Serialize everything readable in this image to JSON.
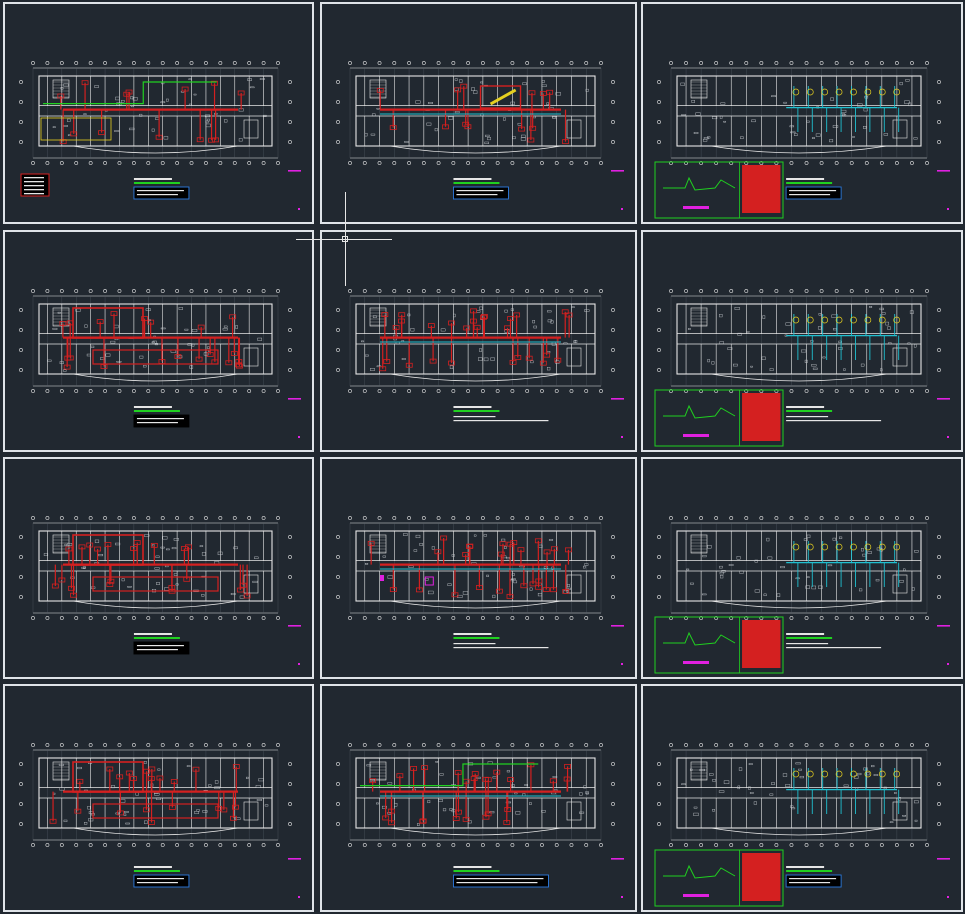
{
  "app": {
    "view": "model-space-multisheet"
  },
  "colors": {
    "background": "#212830",
    "frame": "#dfe3e8",
    "wall": "#e6e6e6",
    "duct_red": "#d42020",
    "green": "#20d020",
    "cyan": "#20c0d0",
    "yellow": "#e6d020",
    "magenta": "#e020e0",
    "blue": "#2c7be0"
  },
  "sheets": [
    {
      "id": "s1",
      "variant": "plan-red-green",
      "legend": "red-box",
      "note": "blue-box"
    },
    {
      "id": "s2",
      "variant": "plan-red-cyan-yellow",
      "legend": "none",
      "note": "blue-box"
    },
    {
      "id": "s3",
      "variant": "plan-cyan",
      "legend": "green-red-box",
      "note": "blue-box"
    },
    {
      "id": "s4",
      "variant": "plan-red-heavy",
      "legend": "none",
      "note": "black-box"
    },
    {
      "id": "s5",
      "variant": "plan-red-dense",
      "legend": "none",
      "note": "plain"
    },
    {
      "id": "s6",
      "variant": "plan-cyan",
      "legend": "green-red-box",
      "note": "plain"
    },
    {
      "id": "s7",
      "variant": "plan-red-heavy",
      "legend": "none",
      "note": "black-box"
    },
    {
      "id": "s8",
      "variant": "plan-red-dense-magenta",
      "legend": "none",
      "note": "plain"
    },
    {
      "id": "s9",
      "variant": "plan-cyan",
      "legend": "green-red-box",
      "note": "plain"
    },
    {
      "id": "s10",
      "variant": "plan-red-heavy",
      "legend": "none",
      "note": "blue-box"
    },
    {
      "id": "s11",
      "variant": "plan-red-dense-green",
      "legend": "none",
      "note": "blue-box-long"
    },
    {
      "id": "s12",
      "variant": "plan-cyan",
      "legend": "green-red-box",
      "note": "blue-box"
    }
  ]
}
